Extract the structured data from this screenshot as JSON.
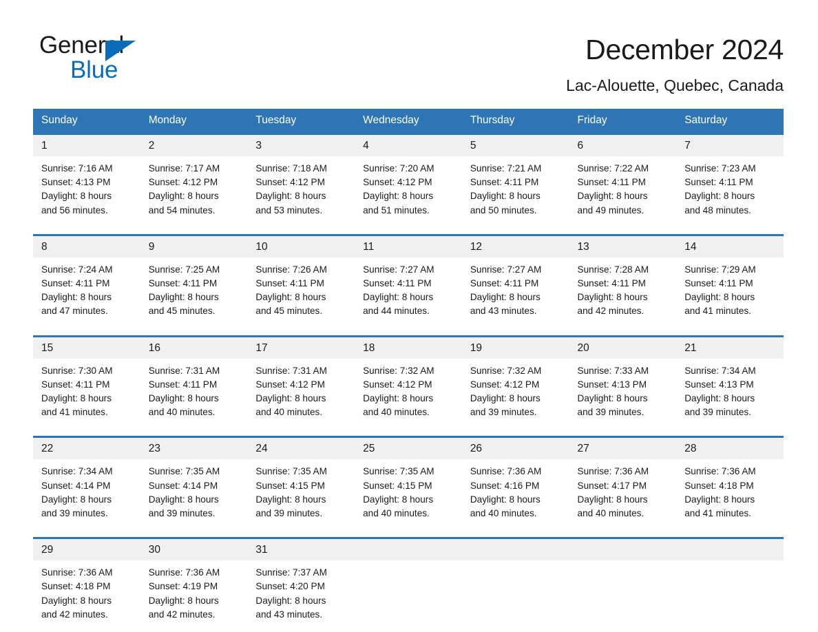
{
  "brand": {
    "name_part1": "General",
    "name_part2": "Blue",
    "triangle_color": "#0a6cb8"
  },
  "header": {
    "month_title": "December 2024",
    "location": "Lac-Alouette, Quebec, Canada"
  },
  "theme": {
    "header_blue": "#2e75b6",
    "row_rule_blue": "#2e75b6",
    "date_band_gray": "#f0f0f0",
    "text_color": "#1a1a1a"
  },
  "weekdays": [
    "Sunday",
    "Monday",
    "Tuesday",
    "Wednesday",
    "Thursday",
    "Friday",
    "Saturday"
  ],
  "weeks": [
    {
      "days": [
        {
          "date": "1",
          "sunrise": "Sunrise: 7:16 AM",
          "sunset": "Sunset: 4:13 PM",
          "daylight_line1": "Daylight: 8 hours",
          "daylight_line2": "and 56 minutes."
        },
        {
          "date": "2",
          "sunrise": "Sunrise: 7:17 AM",
          "sunset": "Sunset: 4:12 PM",
          "daylight_line1": "Daylight: 8 hours",
          "daylight_line2": "and 54 minutes."
        },
        {
          "date": "3",
          "sunrise": "Sunrise: 7:18 AM",
          "sunset": "Sunset: 4:12 PM",
          "daylight_line1": "Daylight: 8 hours",
          "daylight_line2": "and 53 minutes."
        },
        {
          "date": "4",
          "sunrise": "Sunrise: 7:20 AM",
          "sunset": "Sunset: 4:12 PM",
          "daylight_line1": "Daylight: 8 hours",
          "daylight_line2": "and 51 minutes."
        },
        {
          "date": "5",
          "sunrise": "Sunrise: 7:21 AM",
          "sunset": "Sunset: 4:11 PM",
          "daylight_line1": "Daylight: 8 hours",
          "daylight_line2": "and 50 minutes."
        },
        {
          "date": "6",
          "sunrise": "Sunrise: 7:22 AM",
          "sunset": "Sunset: 4:11 PM",
          "daylight_line1": "Daylight: 8 hours",
          "daylight_line2": "and 49 minutes."
        },
        {
          "date": "7",
          "sunrise": "Sunrise: 7:23 AM",
          "sunset": "Sunset: 4:11 PM",
          "daylight_line1": "Daylight: 8 hours",
          "daylight_line2": "and 48 minutes."
        }
      ]
    },
    {
      "days": [
        {
          "date": "8",
          "sunrise": "Sunrise: 7:24 AM",
          "sunset": "Sunset: 4:11 PM",
          "daylight_line1": "Daylight: 8 hours",
          "daylight_line2": "and 47 minutes."
        },
        {
          "date": "9",
          "sunrise": "Sunrise: 7:25 AM",
          "sunset": "Sunset: 4:11 PM",
          "daylight_line1": "Daylight: 8 hours",
          "daylight_line2": "and 45 minutes."
        },
        {
          "date": "10",
          "sunrise": "Sunrise: 7:26 AM",
          "sunset": "Sunset: 4:11 PM",
          "daylight_line1": "Daylight: 8 hours",
          "daylight_line2": "and 45 minutes."
        },
        {
          "date": "11",
          "sunrise": "Sunrise: 7:27 AM",
          "sunset": "Sunset: 4:11 PM",
          "daylight_line1": "Daylight: 8 hours",
          "daylight_line2": "and 44 minutes."
        },
        {
          "date": "12",
          "sunrise": "Sunrise: 7:27 AM",
          "sunset": "Sunset: 4:11 PM",
          "daylight_line1": "Daylight: 8 hours",
          "daylight_line2": "and 43 minutes."
        },
        {
          "date": "13",
          "sunrise": "Sunrise: 7:28 AM",
          "sunset": "Sunset: 4:11 PM",
          "daylight_line1": "Daylight: 8 hours",
          "daylight_line2": "and 42 minutes."
        },
        {
          "date": "14",
          "sunrise": "Sunrise: 7:29 AM",
          "sunset": "Sunset: 4:11 PM",
          "daylight_line1": "Daylight: 8 hours",
          "daylight_line2": "and 41 minutes."
        }
      ]
    },
    {
      "days": [
        {
          "date": "15",
          "sunrise": "Sunrise: 7:30 AM",
          "sunset": "Sunset: 4:11 PM",
          "daylight_line1": "Daylight: 8 hours",
          "daylight_line2": "and 41 minutes."
        },
        {
          "date": "16",
          "sunrise": "Sunrise: 7:31 AM",
          "sunset": "Sunset: 4:11 PM",
          "daylight_line1": "Daylight: 8 hours",
          "daylight_line2": "and 40 minutes."
        },
        {
          "date": "17",
          "sunrise": "Sunrise: 7:31 AM",
          "sunset": "Sunset: 4:12 PM",
          "daylight_line1": "Daylight: 8 hours",
          "daylight_line2": "and 40 minutes."
        },
        {
          "date": "18",
          "sunrise": "Sunrise: 7:32 AM",
          "sunset": "Sunset: 4:12 PM",
          "daylight_line1": "Daylight: 8 hours",
          "daylight_line2": "and 40 minutes."
        },
        {
          "date": "19",
          "sunrise": "Sunrise: 7:32 AM",
          "sunset": "Sunset: 4:12 PM",
          "daylight_line1": "Daylight: 8 hours",
          "daylight_line2": "and 39 minutes."
        },
        {
          "date": "20",
          "sunrise": "Sunrise: 7:33 AM",
          "sunset": "Sunset: 4:13 PM",
          "daylight_line1": "Daylight: 8 hours",
          "daylight_line2": "and 39 minutes."
        },
        {
          "date": "21",
          "sunrise": "Sunrise: 7:34 AM",
          "sunset": "Sunset: 4:13 PM",
          "daylight_line1": "Daylight: 8 hours",
          "daylight_line2": "and 39 minutes."
        }
      ]
    },
    {
      "days": [
        {
          "date": "22",
          "sunrise": "Sunrise: 7:34 AM",
          "sunset": "Sunset: 4:14 PM",
          "daylight_line1": "Daylight: 8 hours",
          "daylight_line2": "and 39 minutes."
        },
        {
          "date": "23",
          "sunrise": "Sunrise: 7:35 AM",
          "sunset": "Sunset: 4:14 PM",
          "daylight_line1": "Daylight: 8 hours",
          "daylight_line2": "and 39 minutes."
        },
        {
          "date": "24",
          "sunrise": "Sunrise: 7:35 AM",
          "sunset": "Sunset: 4:15 PM",
          "daylight_line1": "Daylight: 8 hours",
          "daylight_line2": "and 39 minutes."
        },
        {
          "date": "25",
          "sunrise": "Sunrise: 7:35 AM",
          "sunset": "Sunset: 4:15 PM",
          "daylight_line1": "Daylight: 8 hours",
          "daylight_line2": "and 40 minutes."
        },
        {
          "date": "26",
          "sunrise": "Sunrise: 7:36 AM",
          "sunset": "Sunset: 4:16 PM",
          "daylight_line1": "Daylight: 8 hours",
          "daylight_line2": "and 40 minutes."
        },
        {
          "date": "27",
          "sunrise": "Sunrise: 7:36 AM",
          "sunset": "Sunset: 4:17 PM",
          "daylight_line1": "Daylight: 8 hours",
          "daylight_line2": "and 40 minutes."
        },
        {
          "date": "28",
          "sunrise": "Sunrise: 7:36 AM",
          "sunset": "Sunset: 4:18 PM",
          "daylight_line1": "Daylight: 8 hours",
          "daylight_line2": "and 41 minutes."
        }
      ]
    },
    {
      "days": [
        {
          "date": "29",
          "sunrise": "Sunrise: 7:36 AM",
          "sunset": "Sunset: 4:18 PM",
          "daylight_line1": "Daylight: 8 hours",
          "daylight_line2": "and 42 minutes."
        },
        {
          "date": "30",
          "sunrise": "Sunrise: 7:36 AM",
          "sunset": "Sunset: 4:19 PM",
          "daylight_line1": "Daylight: 8 hours",
          "daylight_line2": "and 42 minutes."
        },
        {
          "date": "31",
          "sunrise": "Sunrise: 7:37 AM",
          "sunset": "Sunset: 4:20 PM",
          "daylight_line1": "Daylight: 8 hours",
          "daylight_line2": "and 43 minutes."
        },
        {
          "date": "",
          "sunrise": "",
          "sunset": "",
          "daylight_line1": "",
          "daylight_line2": ""
        },
        {
          "date": "",
          "sunrise": "",
          "sunset": "",
          "daylight_line1": "",
          "daylight_line2": ""
        },
        {
          "date": "",
          "sunrise": "",
          "sunset": "",
          "daylight_line1": "",
          "daylight_line2": ""
        },
        {
          "date": "",
          "sunrise": "",
          "sunset": "",
          "daylight_line1": "",
          "daylight_line2": ""
        }
      ]
    }
  ]
}
